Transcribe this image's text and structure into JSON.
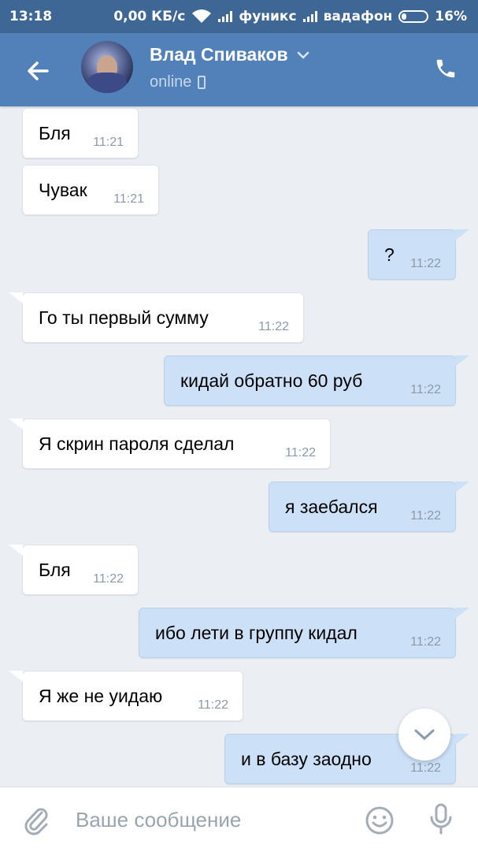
{
  "status_bar": {
    "time": "13:18",
    "net_speed": "0,00 КБ/с",
    "carrier1": "фуникс",
    "carrier2": "вадафон",
    "battery": "16%"
  },
  "header": {
    "contact_name": "Влад Спиваков",
    "status": "online"
  },
  "messages": [
    {
      "dir": "in",
      "text": "Бля",
      "time": "11:21"
    },
    {
      "dir": "in",
      "text": "Чувак",
      "time": "11:21"
    },
    {
      "dir": "out",
      "text": "?",
      "time": "11:22"
    },
    {
      "dir": "in",
      "text": "Го ты первый сумму",
      "time": "11:22"
    },
    {
      "dir": "out",
      "text": "кидай обратно 60 руб",
      "time": "11:22"
    },
    {
      "dir": "in",
      "text": "Я скрин пароля сделал",
      "time": "11:22"
    },
    {
      "dir": "out",
      "text": "я заебался",
      "time": "11:22"
    },
    {
      "dir": "in",
      "text": "Бля",
      "time": "11:22"
    },
    {
      "dir": "out",
      "text": "ибо лети в группу кидал",
      "time": "11:22"
    },
    {
      "dir": "in",
      "text": "Я же не уидаю",
      "time": "11:22"
    },
    {
      "dir": "out",
      "text": "и в базу заодно",
      "time": "11:22"
    }
  ],
  "composer": {
    "placeholder": "Ваше сообщение",
    "attach_icon": "paperclip-icon",
    "emoji_icon": "smile-icon",
    "mic_icon": "microphone-icon"
  },
  "colors": {
    "status_bar": "#3f6795",
    "header": "#5181b8",
    "chat_bg": "#ebeff4",
    "incoming_bubble": "#ffffff",
    "outgoing_bubble": "#cce0f7"
  }
}
